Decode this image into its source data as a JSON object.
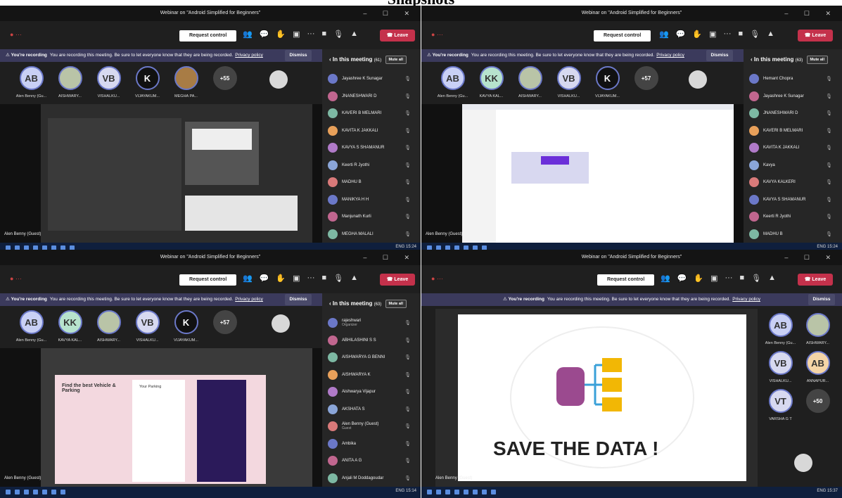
{
  "page_title": "Snapshots",
  "meeting": {
    "title": "Webinar on \"Android Simplified for Beginners\"",
    "request_control": "Request control",
    "leave": "Leave",
    "recording_bold": "You're recording",
    "recording_text": "You are recording this meeting. Be sure to let everyone know that they are being recorded.",
    "privacy_policy": "Privacy policy",
    "dismiss": "Dismiss",
    "in_this_meeting": "In this meeting",
    "mute_all": "Mute all",
    "guest_label": "Alen Benny (Guest)"
  },
  "panel1": {
    "avatars": [
      {
        "initials": "AB",
        "name": "Alen Benny (Gu...",
        "color": "#c9d0f5"
      },
      {
        "initials": "",
        "name": "AISHWARY...",
        "color": "#b9c4a7"
      },
      {
        "initials": "VB",
        "name": "VISHALKU...",
        "color": "#d7d9f0"
      },
      {
        "initials": "K",
        "name": "VIJAYAKUM...",
        "color": "#111111"
      },
      {
        "initials": "",
        "name": "MEGHA PA...",
        "color": "#a87c45"
      },
      {
        "initials": "+55",
        "name": "",
        "color": "#444444"
      }
    ],
    "roster_count": "(61)",
    "roster": [
      "Jayashree K Sunagar",
      "JNANESHWARI D",
      "KAVERI B MELMARI",
      "KAVITA K JAKKALI",
      "KAVYA S SHAMANUR",
      "Keerti R Jyothi",
      "MADHU B",
      "MANIKYA H H",
      "Manjunath Kurli",
      "MEGHA MALALI"
    ],
    "clock": "15:24"
  },
  "panel2": {
    "avatars": [
      {
        "initials": "AB",
        "name": "Alen Benny (Gu...",
        "color": "#c9d0f5"
      },
      {
        "initials": "KK",
        "name": "KAVYA KAL...",
        "color": "#b7e3cd"
      },
      {
        "initials": "",
        "name": "AISHWARY...",
        "color": "#b9c4a7"
      },
      {
        "initials": "VB",
        "name": "VISHALKU...",
        "color": "#d7d9f0"
      },
      {
        "initials": "K",
        "name": "VIJAYAKUM...",
        "color": "#111111"
      },
      {
        "initials": "+57",
        "name": "",
        "color": "#444444"
      }
    ],
    "roster_count": "(63)",
    "roster": [
      "Hemant Chopra",
      "Jayashree K Sunagar",
      "JNANESHWARI D",
      "KAVERI B MELMARI",
      "KAVITA K JAKKALI",
      "Kavya",
      "KAVYA KALKERI",
      "KAVYA S SHAMANUR",
      "Keerti R Jyothi",
      "MADHU B"
    ],
    "clock": "15:24"
  },
  "panel3": {
    "avatars": [
      {
        "initials": "AB",
        "name": "Alen Benny (Gu...",
        "color": "#c9d0f5"
      },
      {
        "initials": "KK",
        "name": "KAVYA KAL...",
        "color": "#b7e3cd"
      },
      {
        "initials": "",
        "name": "AISHWARY...",
        "color": "#b9c4a7"
      },
      {
        "initials": "VB",
        "name": "VISHALKU...",
        "color": "#d7d9f0"
      },
      {
        "initials": "K",
        "name": "VIJAYAKUM...",
        "color": "#111111"
      },
      {
        "initials": "+57",
        "name": "",
        "color": "#444444"
      }
    ],
    "roster_count": "(63)",
    "roster": [
      {
        "name": "rajeshwari",
        "sub": "Organizer"
      },
      {
        "name": "ABHILASHINI S S",
        "sub": ""
      },
      {
        "name": "AISHWARYA G BENNI",
        "sub": ""
      },
      {
        "name": "AISHWARYA K",
        "sub": ""
      },
      {
        "name": "Aishwarya Vijapur",
        "sub": ""
      },
      {
        "name": "AKSHATA S",
        "sub": ""
      },
      {
        "name": "Alen Benny (Guest)",
        "sub": "Guest"
      },
      {
        "name": "Ambika",
        "sub": ""
      },
      {
        "name": "ANITA A G",
        "sub": ""
      },
      {
        "name": "Anjali M Doddagoudar",
        "sub": ""
      }
    ],
    "mockup_heading": "Find the best Vehicle & Parking",
    "mockup_card": "Your Parking",
    "clock": "15:14"
  },
  "panel4": {
    "avatars": [
      {
        "initials": "AB",
        "name": "Alen Benny (Gu...",
        "color": "#c9d0f5"
      },
      {
        "initials": "",
        "name": "AISHWARY...",
        "color": "#b9c4a7"
      },
      {
        "initials": "VB",
        "name": "VISHALKU...",
        "color": "#d7d9f0"
      },
      {
        "initials": "AB",
        "name": "ANNAPUR...",
        "color": "#f5d5a7"
      },
      {
        "initials": "VT",
        "name": "VARSHA G T",
        "color": "#d7d9f0"
      },
      {
        "initials": "+50",
        "name": "",
        "color": "#444444"
      }
    ],
    "slide_title": "SAVE THE DATA !",
    "clock": "15:37"
  },
  "colors": {
    "leave": "#c4314b",
    "recbar": "#3b3a5c",
    "teams_bg": "#1f1f1f",
    "folder": "#f2b705",
    "database": "#9b4a8f"
  }
}
